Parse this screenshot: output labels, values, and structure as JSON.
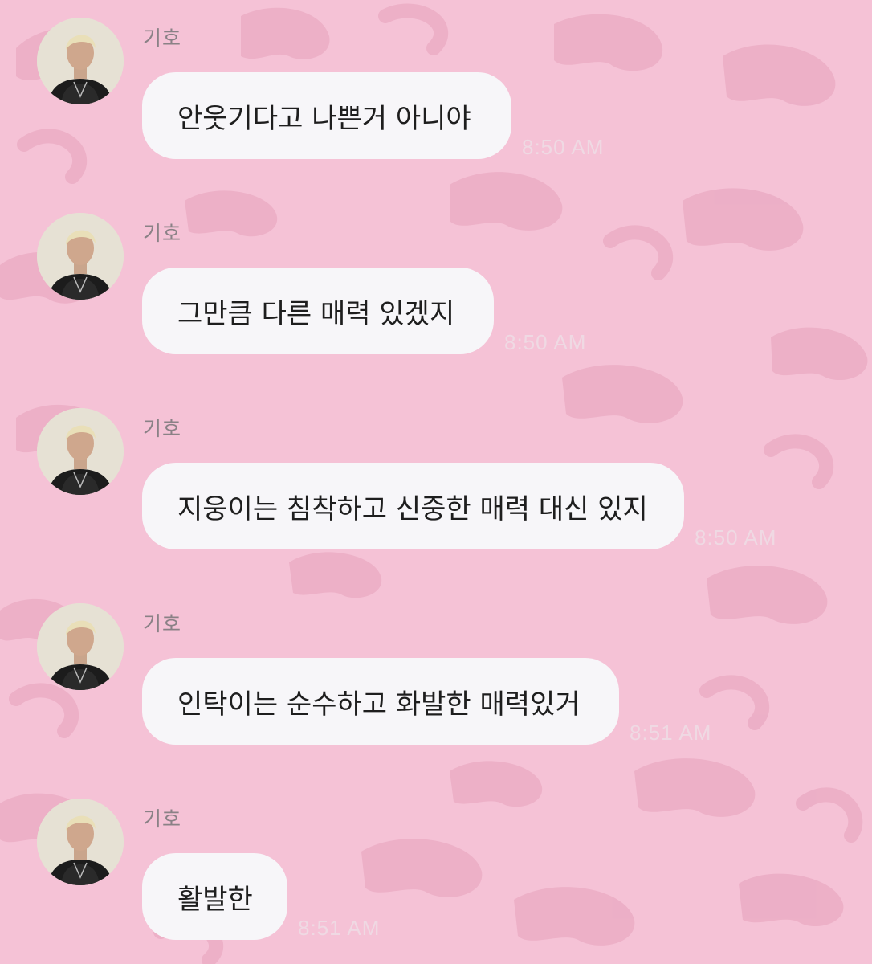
{
  "colors": {
    "background": "#f5c2d6",
    "pattern_spot": "#eaa9c2",
    "bubble": "#f7f6f9",
    "sender_text": "#8a8186",
    "timestamp_text": "#efd9e3"
  },
  "messages": [
    {
      "sender": "기호",
      "text": "안웃기다고 나쁜거 아니야",
      "time": "8:50 AM"
    },
    {
      "sender": "기호",
      "text": "그만큼 다른 매력 있겠지",
      "time": "8:50 AM"
    },
    {
      "sender": "기호",
      "text": "지웅이는 침착하고 신중한 매력 대신 있지",
      "time": "8:50 AM"
    },
    {
      "sender": "기호",
      "text": "인탁이는 순수하고 화발한 매력있거",
      "time": "8:51 AM"
    },
    {
      "sender": "기호",
      "text": "활발한",
      "time": "8:51 AM"
    }
  ]
}
